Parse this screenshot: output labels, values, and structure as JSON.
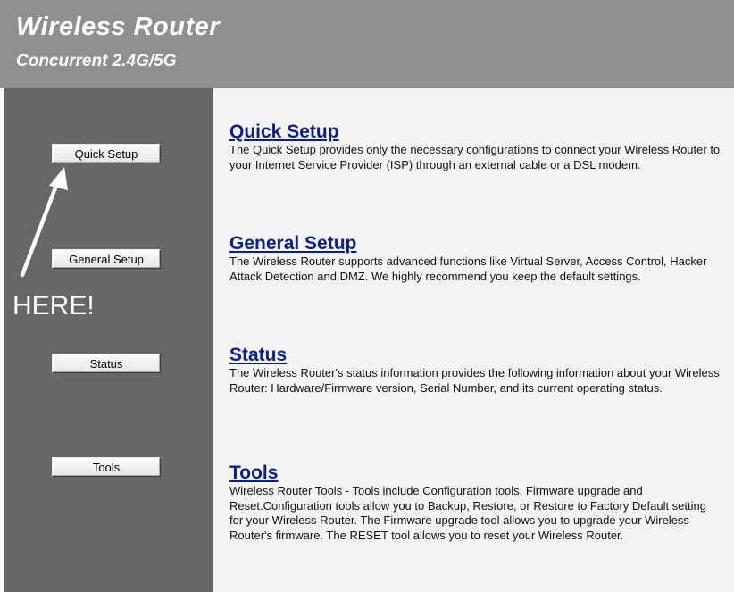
{
  "header": {
    "title": "Wireless Router",
    "subtitle": "Concurrent 2.4G/5G"
  },
  "sidebar": {
    "buttons": [
      {
        "label": "Quick Setup"
      },
      {
        "label": "General Setup"
      },
      {
        "label": "Status"
      },
      {
        "label": "Tools"
      }
    ]
  },
  "annotation": {
    "text": "HERE!",
    "icon": "arrow-icon"
  },
  "sections": [
    {
      "title": "Quick Setup",
      "description": "The Quick Setup provides only the necessary configurations to connect your Wireless Router to your Internet Service Provider (ISP) through an external cable or a DSL modem."
    },
    {
      "title": "General Setup",
      "description": "The Wireless Router supports advanced functions like Virtual Server, Access Control, Hacker Attack Detection and DMZ. We highly recommend you keep the default settings."
    },
    {
      "title": "Status",
      "description": "The Wireless Router's status information provides the following information about your Wireless Router: Hardware/Firmware version, Serial Number, and its current operating status."
    },
    {
      "title": "Tools",
      "description": "Wireless Router Tools - Tools include Configuration tools, Firmware upgrade and Reset.Configuration tools allow you to Backup, Restore, or Restore to Factory Default setting for your Wireless Router. The Firmware upgrade tool allows you to upgrade your Wireless Router's firmware. The RESET tool allows you to reset your Wireless Router."
    }
  ],
  "colors": {
    "header_bg": "#8f8f8f",
    "sidebar_bg": "#676767",
    "content_bg": "#f4f4f4",
    "link": "#0b1f86"
  }
}
